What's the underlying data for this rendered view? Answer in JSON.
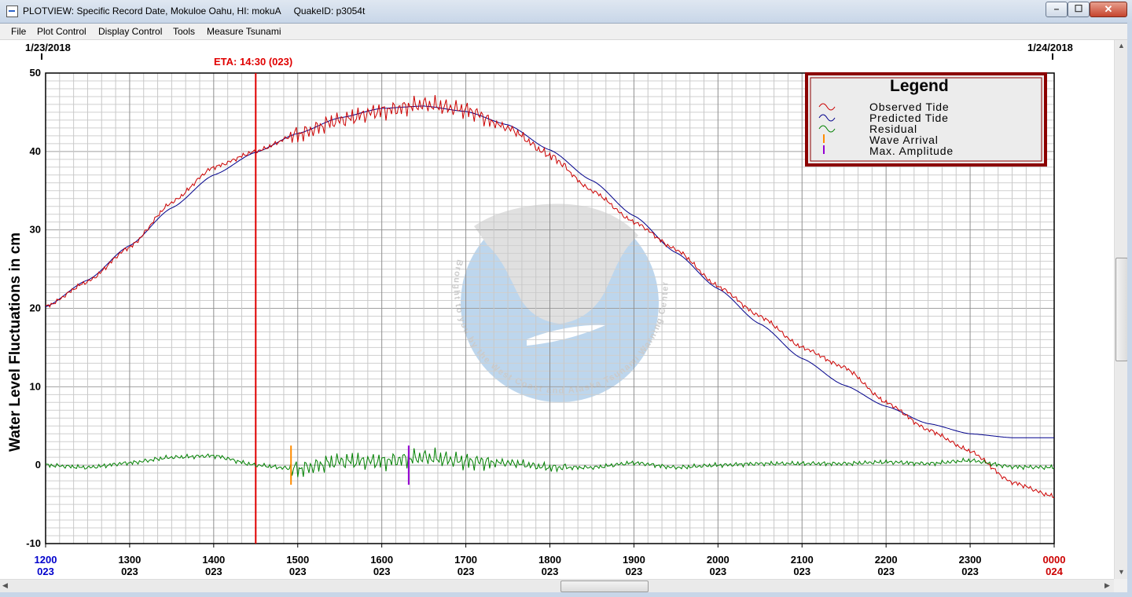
{
  "window": {
    "title": "PLOTVIEW: Specific Record Date, Mokuloe Oahu, HI: mokuA     QuakeID: p3054t",
    "min_glyph": "–",
    "max_glyph": "☐",
    "close_glyph": "✕"
  },
  "menu": [
    "File",
    "Plot Control",
    "Display Control",
    "Tools",
    "Measure Tsunami"
  ],
  "plot": {
    "date_left": "1/23/2018",
    "date_right": "1/24/2018",
    "eta_label": "ETA: 14:30 (023)",
    "ylabel": "Water Level Fluctuations in cm",
    "watermark_text": "Brought to you by the West Coast and Alaska Tsunami Warning Center"
  },
  "legend": {
    "title": "Legend",
    "items": [
      {
        "label": "Observed Tide",
        "color": "#cc0000",
        "icon": "wave-glyph"
      },
      {
        "label": "Predicted Tide",
        "color": "#00008b",
        "icon": "wave-glyph"
      },
      {
        "label": "Residual",
        "color": "#008000",
        "icon": "wave-glyph"
      },
      {
        "label": "Wave Arrival",
        "color": "#ff8c00",
        "icon": "tick-glyph"
      },
      {
        "label": "Max. Amplitude",
        "color": "#9400d3",
        "icon": "tick-glyph"
      }
    ]
  },
  "chart_data": {
    "type": "line",
    "title": "",
    "xlabel": "",
    "ylabel": "Water Level Fluctuations in cm",
    "xlim": [
      1200,
      2400
    ],
    "ylim": [
      -10,
      50
    ],
    "yticks": [
      -10,
      0,
      10,
      20,
      30,
      40,
      50
    ],
    "xticks": [
      {
        "time": "1200",
        "day": "023",
        "color": "#0000cc"
      },
      {
        "time": "1300",
        "day": "023",
        "color": "#000000"
      },
      {
        "time": "1400",
        "day": "023",
        "color": "#000000"
      },
      {
        "time": "1500",
        "day": "023",
        "color": "#000000"
      },
      {
        "time": "1600",
        "day": "023",
        "color": "#000000"
      },
      {
        "time": "1700",
        "day": "023",
        "color": "#000000"
      },
      {
        "time": "1800",
        "day": "023",
        "color": "#000000"
      },
      {
        "time": "1900",
        "day": "023",
        "color": "#000000"
      },
      {
        "time": "2000",
        "day": "023",
        "color": "#000000"
      },
      {
        "time": "2100",
        "day": "023",
        "color": "#000000"
      },
      {
        "time": "2200",
        "day": "023",
        "color": "#000000"
      },
      {
        "time": "2300",
        "day": "023",
        "color": "#000000"
      },
      {
        "time": "0000",
        "day": "024",
        "color": "#cc0000"
      }
    ],
    "grid": true,
    "series": [
      {
        "name": "Predicted Tide",
        "color": "#00008b",
        "x_hours": [
          12.0,
          12.5,
          13.0,
          13.5,
          14.0,
          14.5,
          15.0,
          15.5,
          16.0,
          16.5,
          17.0,
          17.5,
          18.0,
          18.5,
          19.0,
          19.5,
          20.0,
          20.5,
          21.0,
          21.5,
          22.0,
          22.5,
          23.0,
          23.5,
          24.0
        ],
        "values": [
          20.2,
          23.6,
          28.0,
          32.8,
          37.0,
          39.9,
          42.3,
          44.3,
          45.5,
          45.8,
          45.1,
          43.4,
          40.2,
          36.3,
          31.8,
          27.1,
          22.5,
          18.0,
          13.6,
          10.2,
          7.5,
          5.3,
          4.0,
          3.5,
          3.5
        ]
      },
      {
        "name": "Observed Tide",
        "color": "#cc0000",
        "x_hours": [
          12.0,
          12.5,
          13.0,
          13.5,
          14.0,
          14.5,
          15.0,
          15.5,
          16.0,
          16.5,
          17.0,
          17.5,
          18.0,
          18.5,
          19.0,
          19.5,
          20.0,
          20.5,
          21.0,
          21.5,
          22.0,
          22.5,
          23.0,
          23.5,
          24.0
        ],
        "values": [
          20.2,
          23.4,
          27.8,
          33.5,
          38.0,
          40.0,
          42.2,
          44.0,
          45.2,
          46.0,
          45.3,
          43.0,
          39.5,
          35.0,
          31.0,
          27.5,
          22.8,
          19.0,
          15.0,
          12.5,
          8.0,
          4.5,
          1.8,
          -2.2,
          -4.0
        ]
      },
      {
        "name": "Residual",
        "color": "#008000",
        "x_hours": [
          12.0,
          12.5,
          13.0,
          13.5,
          14.0,
          14.5,
          15.0,
          15.5,
          16.0,
          16.5,
          17.0,
          17.5,
          18.0,
          18.5,
          19.0,
          19.5,
          20.0,
          20.5,
          21.0,
          21.5,
          22.0,
          22.5,
          23.0,
          23.5,
          24.0
        ],
        "values": [
          0.0,
          -0.3,
          0.3,
          1.0,
          1.2,
          0.0,
          -0.5,
          0.5,
          0.5,
          1.0,
          0.5,
          0.3,
          -0.3,
          -0.3,
          0.3,
          -0.3,
          0.0,
          0.2,
          0.2,
          0.2,
          0.4,
          0.2,
          0.6,
          -0.2,
          -0.3
        ]
      }
    ],
    "markers": [
      {
        "name": "ETA",
        "x_hour": 14.5,
        "color": "#e00000"
      },
      {
        "name": "Wave Arrival",
        "x_hour": 14.92,
        "y_range": [
          -2.5,
          2.5
        ],
        "color": "#ff8c00"
      },
      {
        "name": "Max. Amplitude",
        "x_hour": 16.32,
        "y_range": [
          -2.5,
          2.5
        ],
        "color": "#9400d3"
      }
    ]
  }
}
